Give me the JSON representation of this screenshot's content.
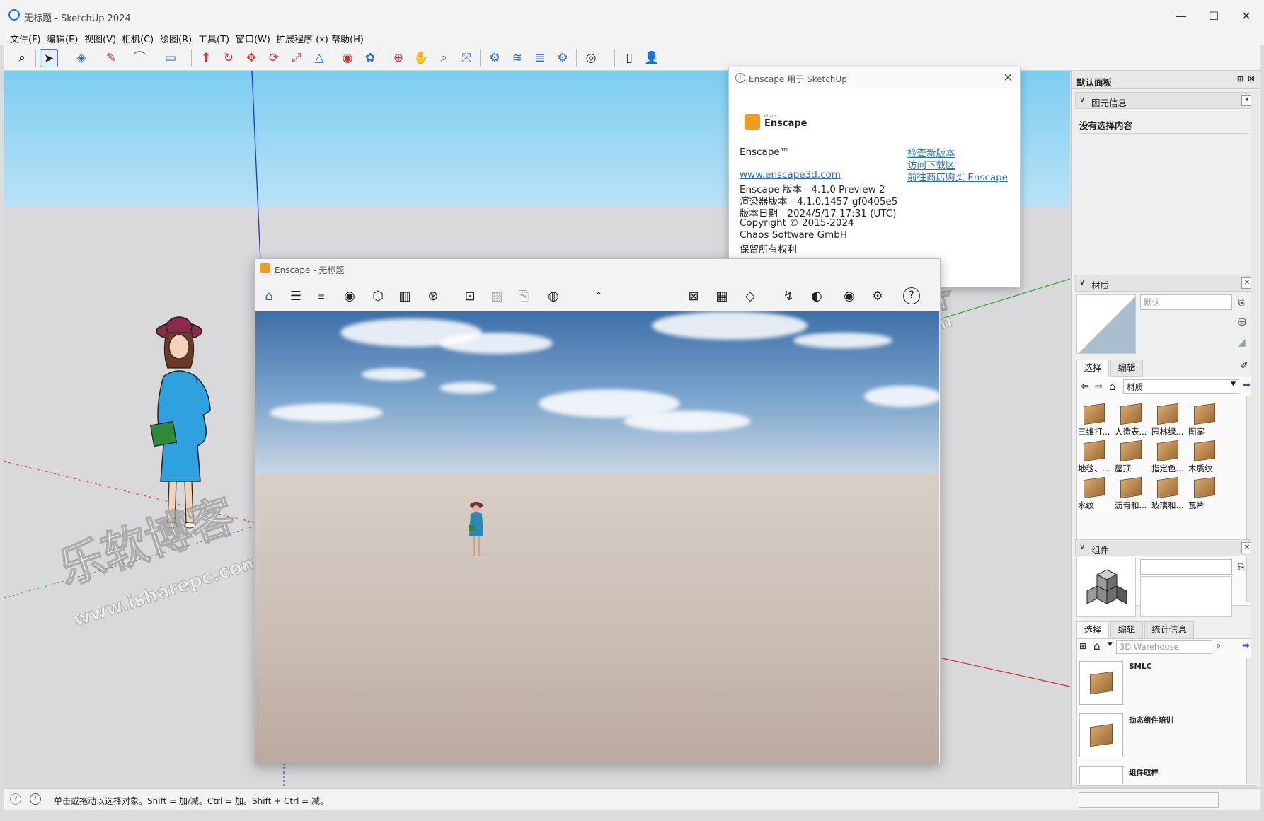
{
  "window": {
    "title": "无标题 - SketchUp 2024",
    "minimize": "—",
    "maximize": "☐",
    "close": "✕"
  },
  "menu": [
    "文件(F)",
    "编辑(E)",
    "视图(V)",
    "相机(C)",
    "绘图(R)",
    "工具(T)",
    "窗口(W)",
    "扩展程序 (x)",
    "帮助(H)"
  ],
  "status": {
    "message": "单击或拖动以选择对象。Shift = 加/减。Ctrl = 加。Shift + Ctrl = 减。"
  },
  "about_dialog": {
    "title": "Enscape 用于 SketchUp",
    "logo_small": "chaos",
    "logo_word": "Enscape",
    "product": "Enscape™",
    "website": "www.enscape3d.com",
    "lines": [
      "Enscape 版本 - 4.1.0 Preview 2",
      "渲染器版本 - 4.1.0.1457-gf0405e5",
      "版本日期 - 2024/5/17 17:31 (UTC)",
      "Copyright © 2015-2024",
      "Chaos Software GmbH",
      "保留所有权利"
    ],
    "links": [
      "检查新版本",
      "访问下载区",
      "前往商店购买 Enscape"
    ]
  },
  "enscape_window": {
    "title": "Enscape - 无标题"
  },
  "panel": {
    "title": "默认面板",
    "entity_info": {
      "label": "图元信息",
      "empty": "没有选择内容"
    },
    "materials": {
      "label": "材质",
      "name_placeholder": "默认",
      "tabs": [
        "选择",
        "编辑"
      ],
      "library": "材质",
      "items": [
        "三维打...",
        "人造表...",
        "园林绿...",
        "图案",
        "地毯、...",
        "屋顶",
        "指定色...",
        "木质纹",
        "水纹",
        "沥青和...",
        "玻璃和...",
        "瓦片"
      ]
    },
    "components": {
      "label": "组件",
      "tabs": [
        "选择",
        "编辑",
        "统计信息"
      ],
      "search_placeholder": "3D Warehouse",
      "items": [
        "SMLC",
        "动态组件培训",
        "组件取样"
      ]
    }
  },
  "watermarks": [
    "乐软博客",
    "www.isharepc.com"
  ]
}
